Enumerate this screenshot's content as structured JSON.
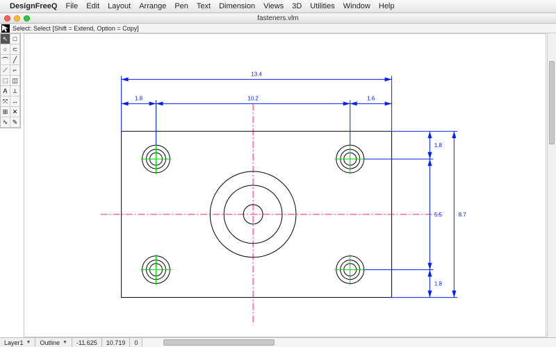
{
  "menubar": {
    "apple": "",
    "items": [
      "DesignFreeQ",
      "File",
      "Edit",
      "Layout",
      "Arrange",
      "Pen",
      "Text",
      "Dimension",
      "Views",
      "3D",
      "Utilities",
      "Window",
      "Help"
    ]
  },
  "window": {
    "title": "fasteners.vlm"
  },
  "toolinfo": {
    "text": "Select: Select  [Shift = Extend, Option = Copy]"
  },
  "tools": {
    "labels": [
      "↖",
      "□",
      "○",
      "⊂",
      "⌒",
      "╱",
      "⟋",
      "⌐",
      "⬚",
      "◫",
      "A",
      "⟂",
      "⤧",
      "↔",
      "⊞",
      "✕",
      "∿",
      "✎"
    ],
    "names": [
      "select",
      "rect",
      "circle",
      "arc",
      "curve",
      "line",
      "polyline",
      "corner",
      "offset",
      "pattern",
      "text",
      "perp",
      "move",
      "mirror",
      "grid",
      "trim",
      "spline",
      "pencil"
    ]
  },
  "status": {
    "layer": "Layer1",
    "style": "Outline",
    "coord_x": "-11.625",
    "coord_y": "10.719",
    "extra": "0"
  },
  "dims": {
    "top_total": "13.4",
    "top_left": "1.8",
    "top_mid": "10.2",
    "top_right": "1.6",
    "right_total": "8.7",
    "right_mid": "5.5",
    "right_gap_top": "1.8",
    "right_gap_bot": "1.8"
  }
}
